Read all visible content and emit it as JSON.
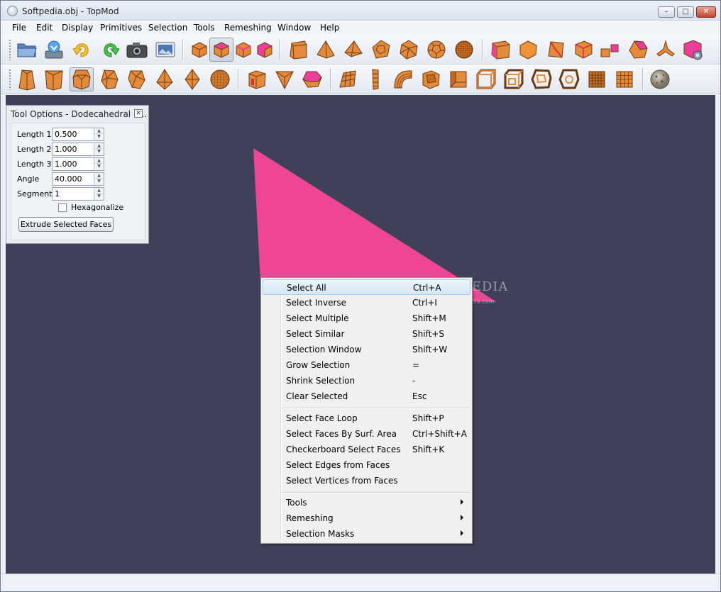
{
  "window": {
    "title": "Softpedia.obj - TopMod",
    "minimize_glyph": "–",
    "maximize_glyph": "□",
    "close_glyph": "✕"
  },
  "menubar": {
    "items": [
      "File",
      "Edit",
      "Display",
      "Primitives",
      "Selection",
      "Tools",
      "Remeshing",
      "Window",
      "Help"
    ]
  },
  "toolbar1": {
    "icons": [
      "open-folder-icon",
      "save-icon",
      "undo-icon",
      "redo-icon",
      "camera-icon",
      "screenshot-icon",
      "vertex-select-mode-icon",
      "face-select-mode-icon",
      "edge-select-mode-icon",
      "corner-select-mode-icon",
      "cube-primitive-icon",
      "tetrahedron-primitive-icon",
      "octahedron-primitive-icon",
      "dodecahedron-primitive-icon",
      "icosahedron-primitive-icon",
      "soccer-ball-primitive-icon",
      "geodesic-sphere-primitive-icon",
      "insert-edge-icon",
      "delete-edge-icon",
      "collapse-edge-icon",
      "subdivide-edge-icon",
      "connect-edges-icon",
      "splice-corners-icon",
      "transform-icon",
      "selection-settings-icon"
    ]
  },
  "toolbar2": {
    "icons": [
      "extrude-face-icon",
      "extrude-double-face-icon",
      "dodecahedral-extrude-icon",
      "icosahedral-extrude-icon",
      "dome-extrude-icon",
      "stellate-icon",
      "double-stellate-icon",
      "cubical-extrude-icon",
      "crust-icon",
      "wireframe-icon",
      "column-icon",
      "sierpinsky-icon",
      "multi-face-handle-icon",
      "hole-handle-icon",
      "corner-cut-icon",
      "pipe-handle-icon",
      "loop-handle-icon",
      "torus-handle-icon",
      "sculpting-icon",
      "wireframe-cube-icon",
      "lattice-icon",
      "checker-cube-icon",
      "texture-sphere-icon"
    ]
  },
  "tool_options": {
    "title": "Tool Options - Dodecahedral E...",
    "close_glyph": "✕",
    "fields": [
      {
        "label": "Length 1",
        "value": "0.500"
      },
      {
        "label": "Length 2",
        "value": "1.000"
      },
      {
        "label": "Length 3",
        "value": "1.000"
      },
      {
        "label": "Angle",
        "value": "40.000"
      },
      {
        "label": "Segments",
        "value": "1"
      }
    ],
    "spin_up_glyph": "▲",
    "spin_down_glyph": "▼",
    "checkbox_label": "Hexagonalize",
    "checkbox_checked": false,
    "button_label": "Extrude Selected Faces"
  },
  "viewport": {
    "background": "#41405a",
    "shape_color": "#ee4596"
  },
  "watermark": {
    "text": "SOFTPEDIA",
    "sub": "www.softpedia.com"
  },
  "context_menu": {
    "groups": [
      [
        {
          "label": "Select All",
          "shortcut": "Ctrl+A"
        },
        {
          "label": "Select Inverse",
          "shortcut": "Ctrl+I"
        },
        {
          "label": "Select Multiple",
          "shortcut": "Shift+M"
        },
        {
          "label": "Select Similar",
          "shortcut": "Shift+S"
        },
        {
          "label": "Selection Window",
          "shortcut": "Shift+W"
        },
        {
          "label": "Grow Selection",
          "shortcut": "="
        },
        {
          "label": "Shrink Selection",
          "shortcut": "-"
        },
        {
          "label": "Clear Selected",
          "shortcut": "Esc"
        }
      ],
      [
        {
          "label": "Select Face Loop",
          "shortcut": "Shift+P"
        },
        {
          "label": "Select Faces By Surf. Area",
          "shortcut": "Ctrl+Shift+A"
        },
        {
          "label": "Checkerboard Select Faces",
          "shortcut": "Shift+K"
        },
        {
          "label": "Select Edges from Faces",
          "shortcut": ""
        },
        {
          "label": "Select Vertices from Faces",
          "shortcut": ""
        }
      ],
      [
        {
          "label": "Tools",
          "shortcut": "",
          "submenu": true
        },
        {
          "label": "Remeshing",
          "shortcut": "",
          "submenu": true
        },
        {
          "label": "Selection Masks",
          "shortcut": "",
          "submenu": true
        }
      ]
    ],
    "highlighted": "Select All"
  }
}
